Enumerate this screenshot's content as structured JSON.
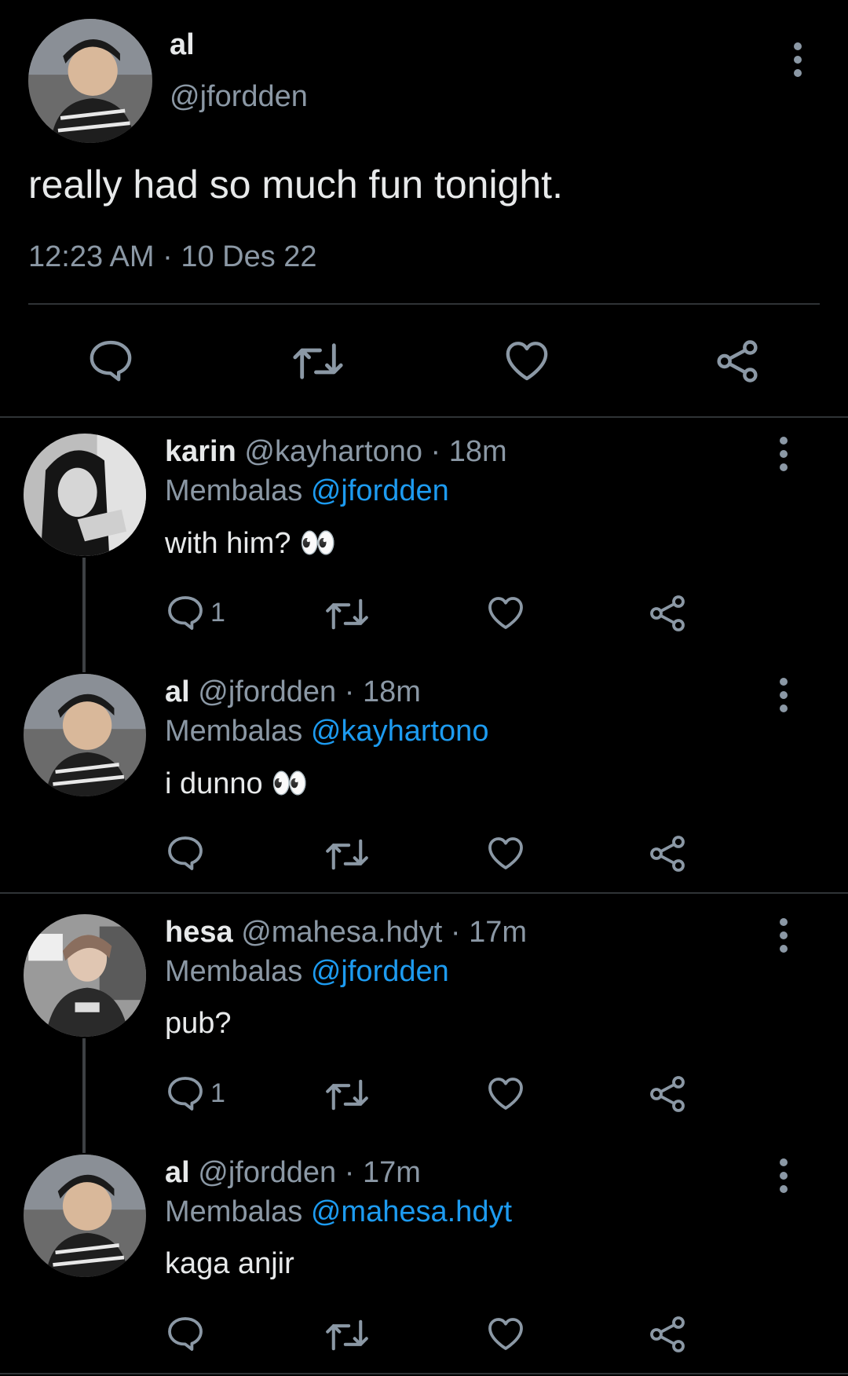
{
  "main_tweet": {
    "name": "al",
    "handle": "@jfordden",
    "text": "really had so much fun tonight.",
    "time": "12:23 AM",
    "separator": "·",
    "date": "10 Des 22"
  },
  "replies": [
    {
      "name": "karin",
      "handle": "@kayhartono",
      "separator": "·",
      "time": "18m",
      "replying_label": "Membalas",
      "replying_to": "@jfordden",
      "text": "with him? 👀",
      "reply_count": "1"
    },
    {
      "name": "al",
      "handle": "@jfordden",
      "separator": "·",
      "time": "18m",
      "replying_label": "Membalas",
      "replying_to": "@kayhartono",
      "text": "i dunno 👀",
      "reply_count": ""
    },
    {
      "name": "hesa",
      "handle": "@mahesa.hdyt",
      "separator": "·",
      "time": "17m",
      "replying_label": "Membalas",
      "replying_to": "@jfordden",
      "text": "pub?",
      "reply_count": "1"
    },
    {
      "name": "al",
      "handle": "@jfordden",
      "separator": "·",
      "time": "17m",
      "replying_label": "Membalas",
      "replying_to": "@mahesa.hdyt",
      "text": "kaga anjir",
      "reply_count": ""
    }
  ],
  "icons": {
    "reply": "reply-icon",
    "retweet": "retweet-icon",
    "like": "like-icon",
    "share": "share-icon",
    "more": "more-options-icon"
  },
  "colors": {
    "background": "#000000",
    "text": "#e7e9ea",
    "secondary": "#8b98a5",
    "accent": "#1d9bf0",
    "divider": "#2f3336"
  }
}
